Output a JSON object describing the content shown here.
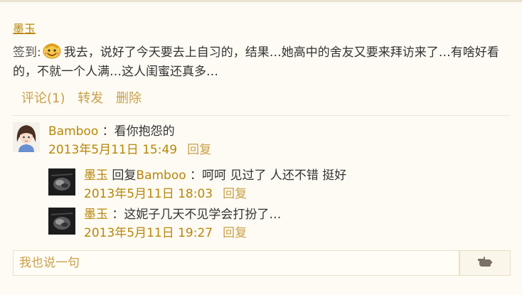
{
  "post": {
    "author": "墨玉",
    "mood_label": "签到:",
    "text": "我去，说好了今天要去上自习的，结果…她高中的舍友又要来拜访来了…有啥好看的，不就一个人满…这人闺蜜还真多…",
    "emoji": "happy-face-emoji"
  },
  "actions": {
    "comment_label": "评论(1)",
    "forward_label": "转发",
    "delete_label": "删除"
  },
  "comments": [
    {
      "name": "Bamboo",
      "text": "：看你抱怨的",
      "time": "2013年5月11日 15:49",
      "reply_label": "回复"
    }
  ],
  "replies": [
    {
      "name": "墨玉",
      "reply_prefix": "回复",
      "reply_to": "Bamboo",
      "text": "：呵呵 见过了 人还不错 挺好",
      "time": "2013年5月11日 18:03",
      "reply_label": "回复"
    },
    {
      "name": "墨玉",
      "text": "：这妮子几天不见学会打扮了…",
      "time": "2013年5月11日 19:27",
      "reply_label": "回复"
    }
  ],
  "input": {
    "placeholder": "我也说一句"
  },
  "colors": {
    "accent": "#b8860b",
    "background": "#fdfbf3"
  }
}
